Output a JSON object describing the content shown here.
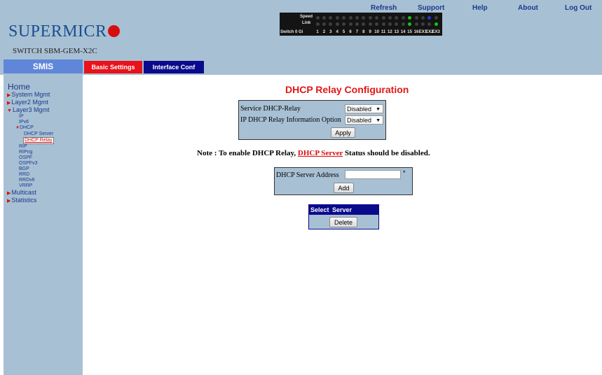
{
  "header": {
    "brand": "SUPERMICR",
    "model": "SWITCH SBM-GEM-X2C",
    "links": [
      "Refresh",
      "Support",
      "Help",
      "About",
      "Log Out"
    ]
  },
  "port_panel": {
    "speed_label": "Speed",
    "link_label": "Link",
    "switch_label": "Switch 0 Gi",
    "ports": [
      "1",
      "2",
      "3",
      "4",
      "5",
      "6",
      "7",
      "8",
      "9",
      "10",
      "11",
      "12",
      "13",
      "14",
      "15",
      "16",
      "EX1",
      "EX2",
      "EX3"
    ],
    "speed_leds": [
      "off",
      "off",
      "off",
      "off",
      "off",
      "off",
      "off",
      "off",
      "off",
      "off",
      "off",
      "off",
      "off",
      "off",
      "green",
      "off",
      "off",
      "blue",
      "off"
    ],
    "link_leds": [
      "off",
      "off",
      "off",
      "off",
      "off",
      "off",
      "off",
      "off",
      "off",
      "off",
      "off",
      "off",
      "off",
      "off",
      "green",
      "off",
      "off",
      "off",
      "green"
    ]
  },
  "nav": {
    "smis": "SMIS",
    "tabs": [
      "Basic Settings",
      "Interface Conf"
    ]
  },
  "sidebar": {
    "home": "Home",
    "items": {
      "system_mgmt": "System Mgmt",
      "layer2_mgmt": "Layer2 Mgmt",
      "layer3_mgmt": "Layer3 Mgmt",
      "ip": "IP",
      "ipv6": "IPv6",
      "dhcp": "DHCP",
      "dhcp_server": "DHCP Server",
      "dhcp_relay": "DHCP Relay",
      "rip": "RIP",
      "ripng": "RIPng",
      "ospf": "OSPF",
      "ospfv3": "OSPFv3",
      "bgp": "BGP",
      "rrd": "RRD",
      "rrdv6": "RRDv6",
      "vrrp": "VRRP",
      "multicast": "Multicast",
      "statistics": "Statistics"
    }
  },
  "main": {
    "title": "DHCP Relay Configuration",
    "relay_form": {
      "service_label": "Service DHCP-Relay",
      "service_value": "Disabled",
      "info_option_label": "IP DHCP Relay Information Option",
      "info_option_value": "Disabled",
      "apply": "Apply"
    },
    "note": {
      "prefix": "Note : To enable DHCP Relay,",
      "link": "DHCP Server",
      "suffix": "Status should be disabled."
    },
    "server_form": {
      "label": "DHCP Server Address",
      "value": "",
      "required": "*",
      "add": "Add"
    },
    "table": {
      "headers": [
        "Select",
        "Server Address"
      ],
      "delete": "Delete"
    }
  },
  "colors": {
    "header_bg": "#a8c0d4",
    "title_red": "#e01818",
    "tab_red": "#e8121a",
    "tab_navy": "#0a0a8c",
    "smis_blue": "#5f86d8"
  }
}
